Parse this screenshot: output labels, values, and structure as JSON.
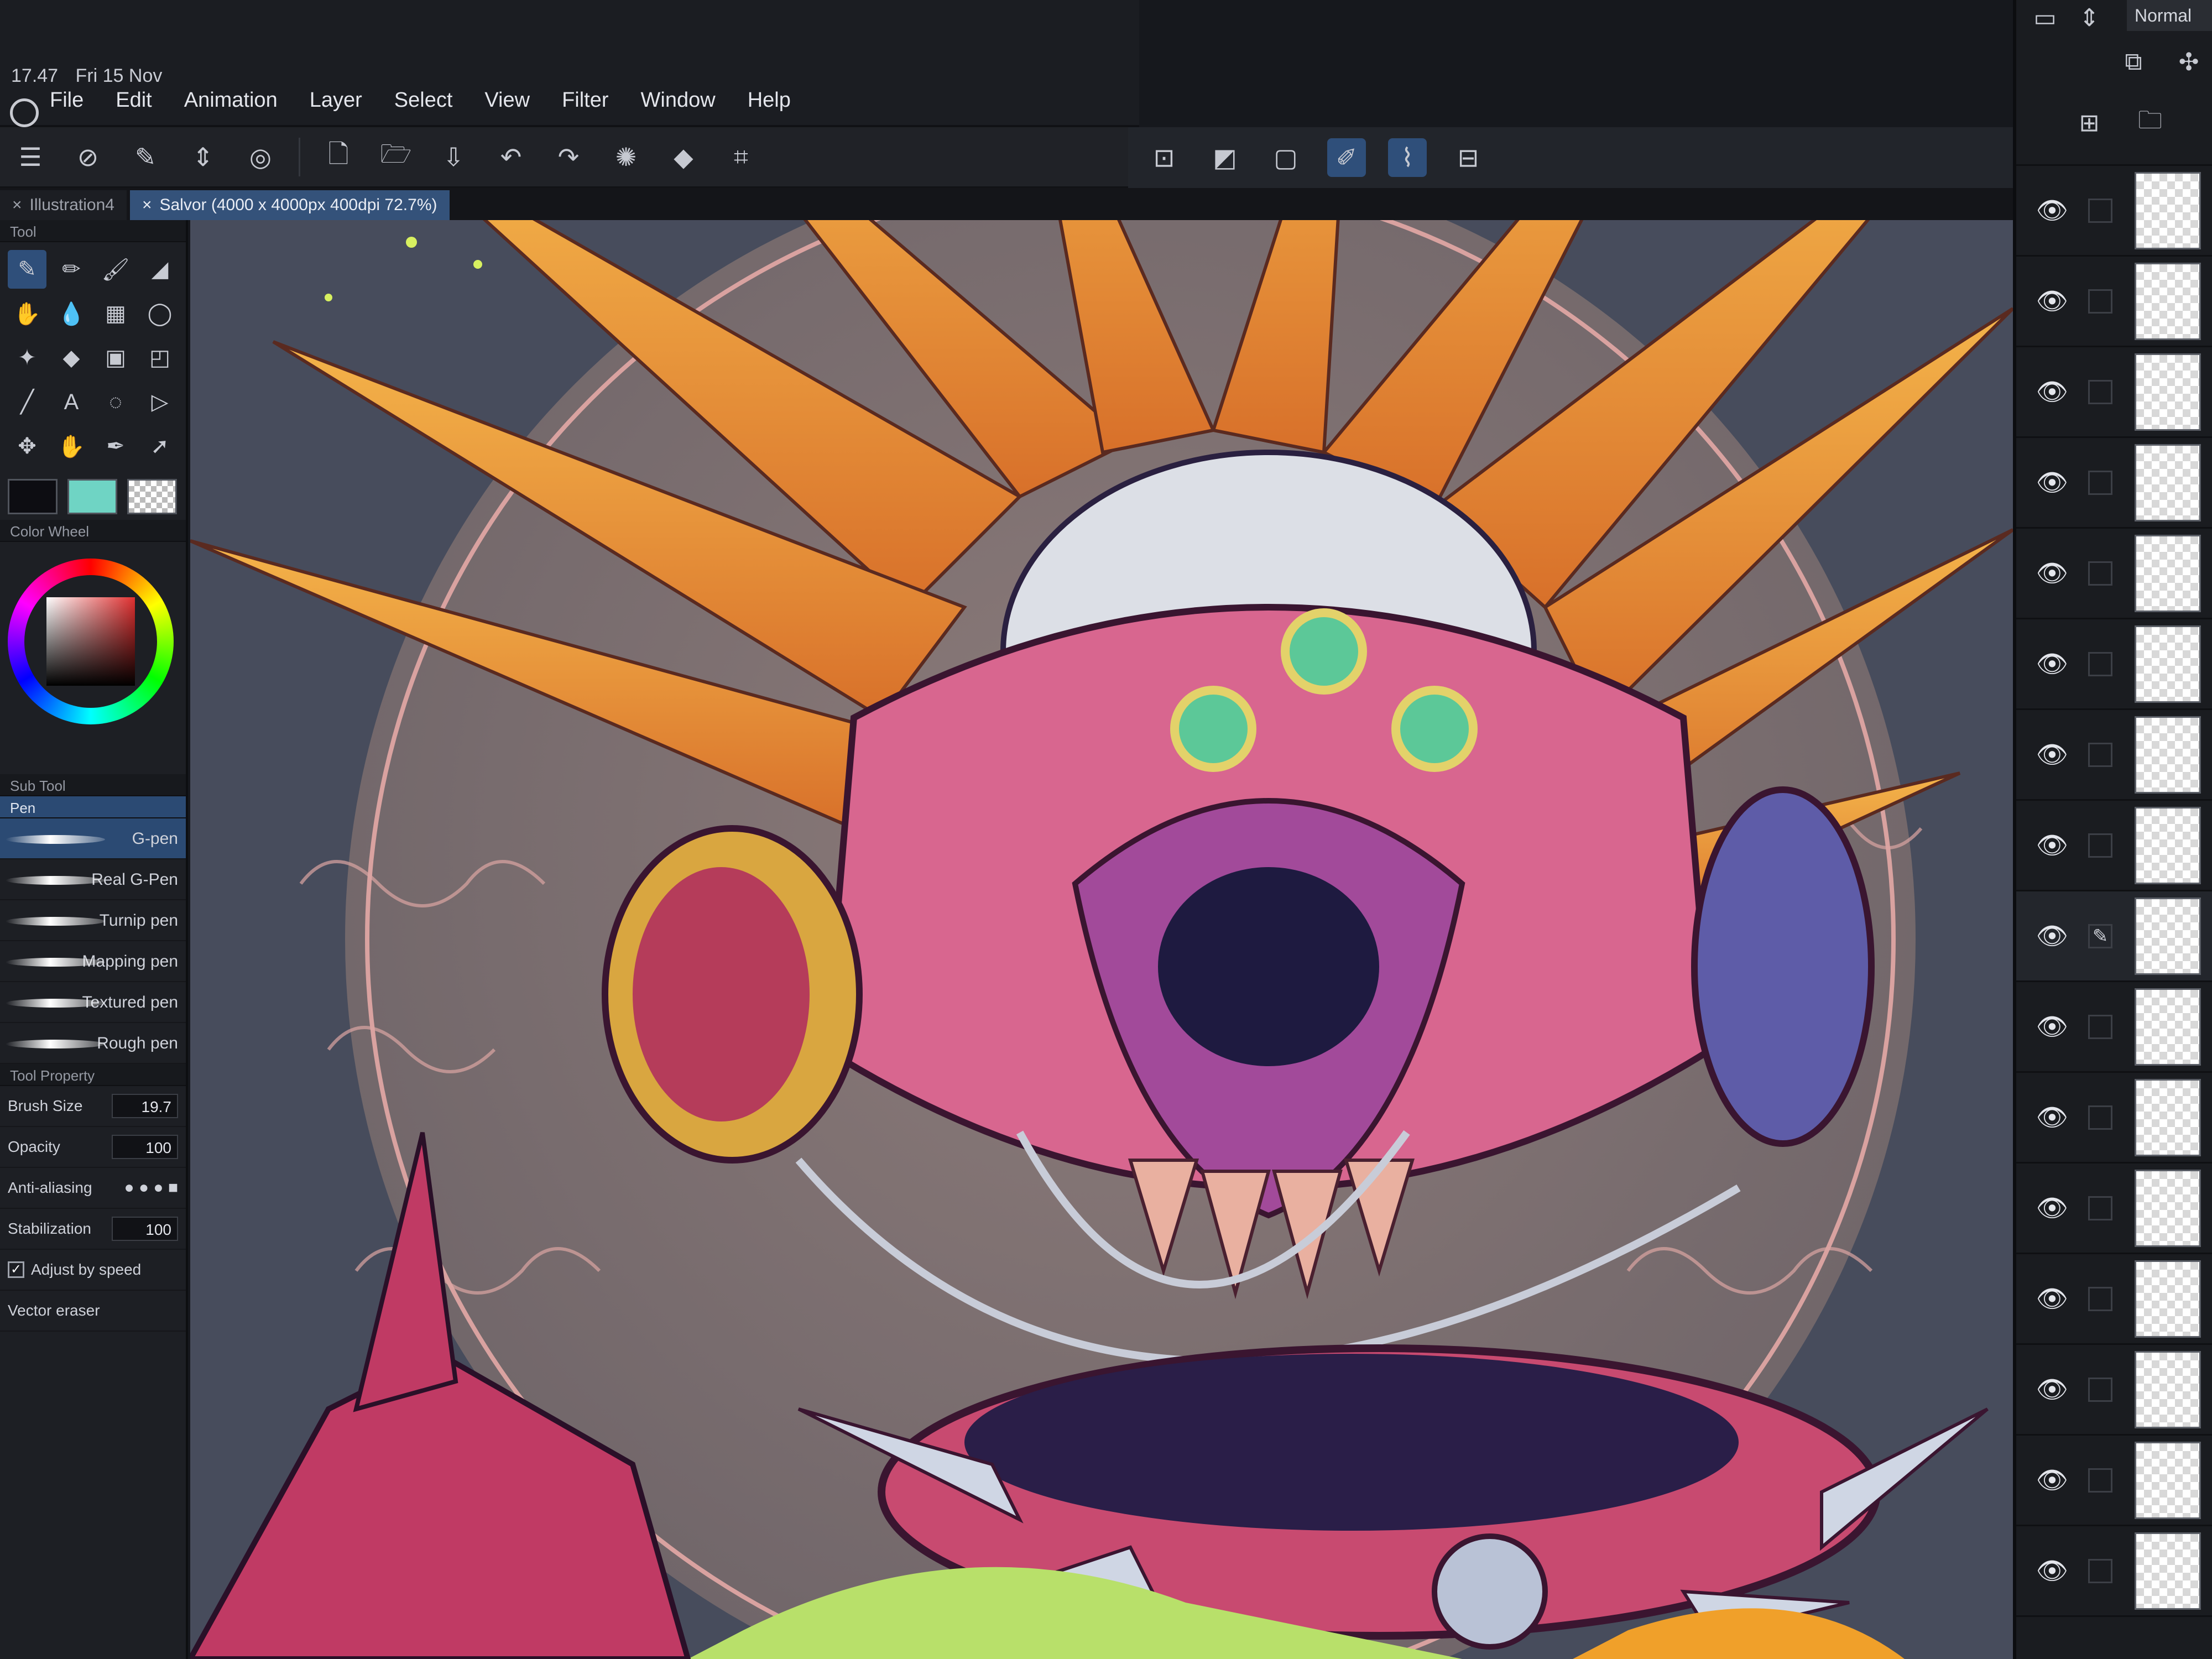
{
  "system": {
    "time": "17.47",
    "date": "Fri 15 Nov"
  },
  "menu": [
    "File",
    "Edit",
    "Animation",
    "Layer",
    "Select",
    "View",
    "Filter",
    "Window",
    "Help"
  ],
  "tabs": [
    {
      "label": "Illustration4",
      "active": false
    },
    {
      "label": "Salvor (4000 x 4000px 400dpi 72.7%)",
      "active": true
    }
  ],
  "left_panels": {
    "tool_panel_title": "Tool",
    "color_wheel_title": "Color Wheel",
    "sub_tool_title": "Sub Tool",
    "sub_tool_group": "Pen",
    "brushes": [
      "G-pen",
      "Real G-Pen",
      "Turnip pen",
      "Mapping pen",
      "Textured pen",
      "Rough pen"
    ],
    "active_brush_index": 0,
    "tool_property_title": "Tool Property",
    "properties": [
      {
        "label": "Brush Size",
        "value": "19.7"
      },
      {
        "label": "Opacity",
        "value": "100"
      },
      {
        "label": "Anti-aliasing",
        "value": ""
      },
      {
        "label": "Stabilization",
        "value": "100"
      }
    ],
    "adjust_by_speed": "Adjust by speed",
    "vector_label": "Vector eraser",
    "main_color": "#0d0d12",
    "sub_color": "#6fd4c4"
  },
  "layers": {
    "blend_mode": "Normal",
    "count": 16,
    "active_index": 8
  },
  "colors": {
    "accent": "#2f4f7a",
    "canvas_bg": "#8c7a7a",
    "skull_pink": "#d8668f",
    "spike_orange": "#f0a02a",
    "lime": "#d8f060"
  }
}
